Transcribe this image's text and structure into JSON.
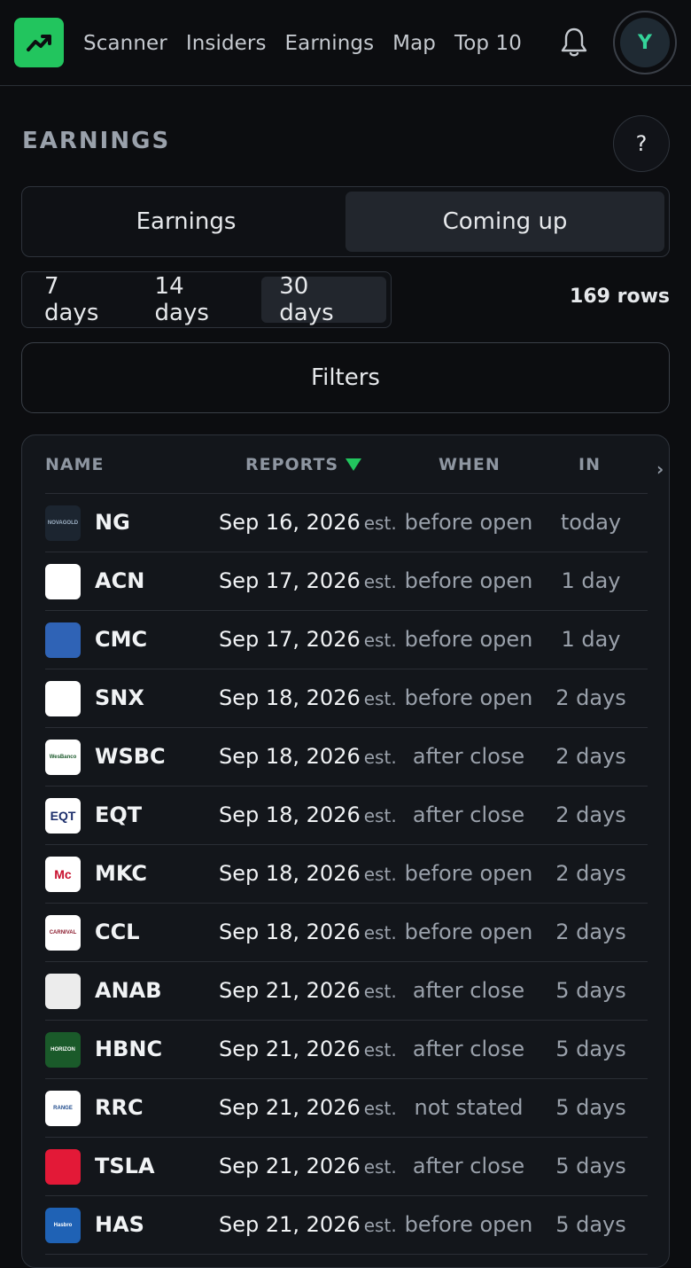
{
  "nav": {
    "items": [
      {
        "label": "Scanner"
      },
      {
        "label": "Insiders"
      },
      {
        "label": "Earnings"
      },
      {
        "label": "Map"
      },
      {
        "label": "Top 10"
      }
    ],
    "avatar_initial": "Y"
  },
  "page": {
    "title": "EARNINGS",
    "help_label": "?"
  },
  "main_tabs": [
    {
      "label": "Earnings",
      "active": false
    },
    {
      "label": "Coming up",
      "active": true
    }
  ],
  "range_tabs": [
    {
      "label": "7 days",
      "active": false
    },
    {
      "label": "14 days",
      "active": false
    },
    {
      "label": "30 days",
      "active": true
    }
  ],
  "row_count": "169 rows",
  "filters_label": "Filters",
  "table": {
    "columns": {
      "name": "NAME",
      "reports": "REPORTS",
      "when": "WHEN",
      "in": "IN"
    },
    "scroll_glyph": "›",
    "sort": {
      "column": "reports",
      "direction": "descending",
      "color": "#22c55e"
    },
    "rows": [
      {
        "ticker": "NG",
        "date": "Sep 16, 2026",
        "est": "est.",
        "when": "before open",
        "in": "today",
        "logo_text": "NOVAGOLD",
        "logo_bg": "#1c2530",
        "logo_fg": "#9fb2c6"
      },
      {
        "ticker": "ACN",
        "date": "Sep 17, 2026",
        "est": "est.",
        "when": "before open",
        "in": "1 day",
        "logo_text": "",
        "logo_bg": "#ffffff",
        "logo_fg": "#a100ff"
      },
      {
        "ticker": "CMC",
        "date": "Sep 17, 2026",
        "est": "est.",
        "when": "before open",
        "in": "1 day",
        "logo_text": "",
        "logo_bg": "#2f63b6",
        "logo_fg": "#ffffff"
      },
      {
        "ticker": "SNX",
        "date": "Sep 18, 2026",
        "est": "est.",
        "when": "before open",
        "in": "2 days",
        "logo_text": "",
        "logo_bg": "#ffffff",
        "logo_fg": "#1aa6c8"
      },
      {
        "ticker": "WSBC",
        "date": "Sep 18, 2026",
        "est": "est.",
        "when": "after close",
        "in": "2 days",
        "logo_text": "WesBanco",
        "logo_bg": "#ffffff",
        "logo_fg": "#1c5a2c"
      },
      {
        "ticker": "EQT",
        "date": "Sep 18, 2026",
        "est": "est.",
        "when": "after close",
        "in": "2 days",
        "logo_text": "EQT",
        "logo_bg": "#ffffff",
        "logo_fg": "#1c2e6b"
      },
      {
        "ticker": "MKC",
        "date": "Sep 18, 2026",
        "est": "est.",
        "when": "before open",
        "in": "2 days",
        "logo_text": "Mc",
        "logo_bg": "#ffffff",
        "logo_fg": "#c8102e"
      },
      {
        "ticker": "CCL",
        "date": "Sep 18, 2026",
        "est": "est.",
        "when": "before open",
        "in": "2 days",
        "logo_text": "CARNIVAL",
        "logo_bg": "#ffffff",
        "logo_fg": "#8c1d2f"
      },
      {
        "ticker": "ANAB",
        "date": "Sep 21, 2026",
        "est": "est.",
        "when": "after close",
        "in": "5 days",
        "logo_text": "",
        "logo_bg": "#ececec",
        "logo_fg": "#e38b2c"
      },
      {
        "ticker": "HBNC",
        "date": "Sep 21, 2026",
        "est": "est.",
        "when": "after close",
        "in": "5 days",
        "logo_text": "HORIZON",
        "logo_bg": "#1a5a2a",
        "logo_fg": "#ffffff"
      },
      {
        "ticker": "RRC",
        "date": "Sep 21, 2026",
        "est": "est.",
        "when": "not stated",
        "in": "5 days",
        "logo_text": "RANGE",
        "logo_bg": "#ffffff",
        "logo_fg": "#1e4a8c"
      },
      {
        "ticker": "TSLA",
        "date": "Sep 21, 2026",
        "est": "est.",
        "when": "after close",
        "in": "5 days",
        "logo_text": "",
        "logo_bg": "#e31937",
        "logo_fg": "#ffffff"
      },
      {
        "ticker": "HAS",
        "date": "Sep 21, 2026",
        "est": "est.",
        "when": "before open",
        "in": "5 days",
        "logo_text": "Hasbro",
        "logo_bg": "#1f62b5",
        "logo_fg": "#ffffff"
      }
    ]
  },
  "colors": {
    "accent": "#22c55e",
    "background": "#0c0d10",
    "card": "#13161b"
  }
}
